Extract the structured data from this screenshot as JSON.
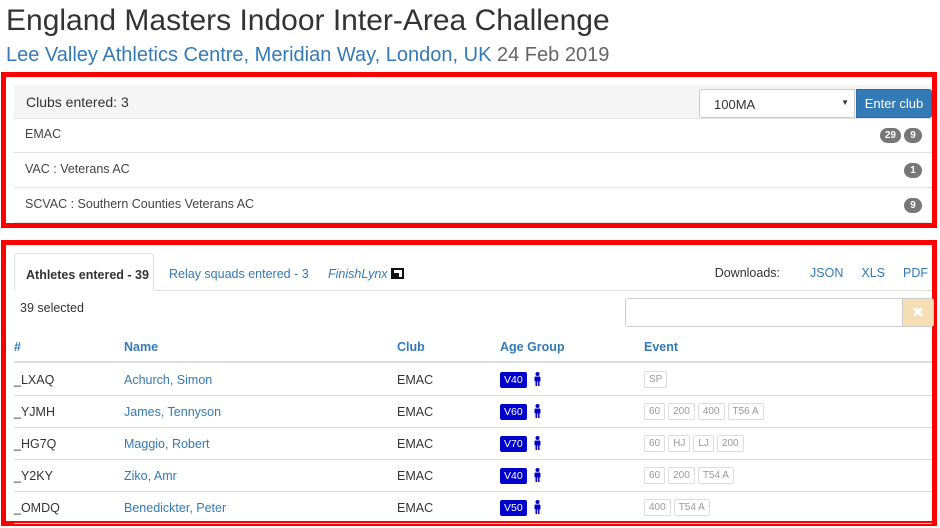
{
  "header": {
    "title": "England Masters Indoor Inter-Area Challenge",
    "venue": "Lee Valley Athletics Centre, Meridian Way, London, UK",
    "date": "24 Feb 2019"
  },
  "clubs_panel": {
    "count_label": "Clubs entered: 3",
    "select_value": "100MA",
    "enter_button": "Enter club",
    "clubs": [
      {
        "name": "EMAC",
        "badges": [
          "29",
          "9"
        ]
      },
      {
        "name": "VAC : Veterans AC",
        "badges": [
          "1"
        ]
      },
      {
        "name": "SCVAC : Southern Counties Veterans AC",
        "badges": [
          "9"
        ]
      }
    ]
  },
  "tabs": {
    "athletes": "Athletes entered - 39",
    "relay": "Relay squads entered - 3",
    "finishlynx": "FinishLynx"
  },
  "downloads": {
    "label": "Downloads:",
    "json": "JSON",
    "xls": "XLS",
    "pdf": "PDF"
  },
  "selected_label": "39 selected",
  "filter_placeholder": "",
  "clear_icon": "✖",
  "table": {
    "headers": {
      "id": "#",
      "name": "Name",
      "club": "Club",
      "age": "Age Group",
      "event": "Event"
    },
    "rows": [
      {
        "id": "_LXAQ",
        "name": "Achurch, Simon",
        "club": "EMAC",
        "age": "V40",
        "events": [
          "SP"
        ]
      },
      {
        "id": "_YJMH",
        "name": "James, Tennyson",
        "club": "EMAC",
        "age": "V60",
        "events": [
          "60",
          "200",
          "400",
          "T56 A"
        ]
      },
      {
        "id": "_HG7Q",
        "name": "Maggio, Robert",
        "club": "EMAC",
        "age": "V70",
        "events": [
          "60",
          "HJ",
          "LJ",
          "200"
        ]
      },
      {
        "id": "_Y2KY",
        "name": "Ziko, Amr",
        "club": "EMAC",
        "age": "V40",
        "events": [
          "60",
          "200",
          "T54 A"
        ]
      },
      {
        "id": "_OMDQ",
        "name": "Benedickter, Peter",
        "club": "EMAC",
        "age": "V50",
        "events": [
          "400",
          "T54 A"
        ]
      }
    ]
  },
  "colors": {
    "accent": "#337ab7",
    "age_badge": "#0000cd",
    "highlight_border": "#ff0000"
  }
}
